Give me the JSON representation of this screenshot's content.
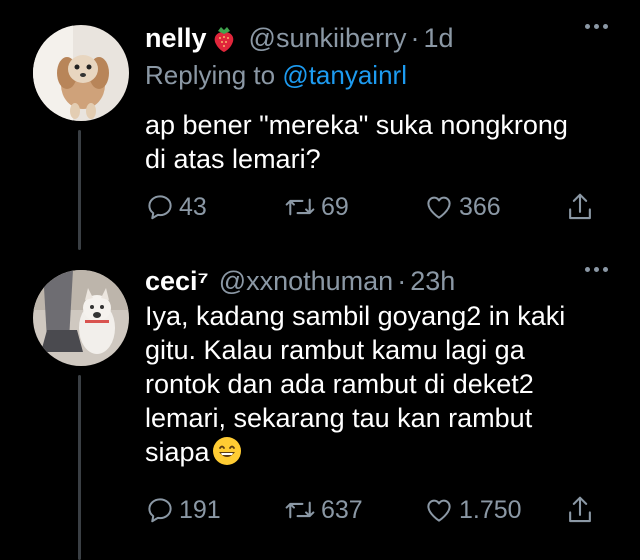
{
  "tweets": [
    {
      "display_name": "nelly",
      "name_emoji": "strawberry-emoji",
      "handle": "@sunkiiberry",
      "time_separator": "·",
      "time": "1d",
      "replying_prefix": "Replying to",
      "replying_to": "@tanyainrl",
      "text_lines": [
        "ap bener \"mereka\" suka nongkrong",
        "di atas lemari?"
      ],
      "replies": "43",
      "retweets": "69",
      "likes": "366",
      "avatar": "puppy-photo"
    },
    {
      "display_name": "ceci⁷",
      "handle": "@xxnothuman",
      "time_separator": "·",
      "time": "23h",
      "text_lines": [
        "Iya, kadang sambil goyang2 in kaki",
        "gitu. Kalau rambut kamu lagi ga",
        "rontok dan ada rambut di deket2",
        "lemari, sekarang tau kan rambut",
        "siapa"
      ],
      "text_emoji": "grinning-face-emoji",
      "replies": "191",
      "retweets": "637",
      "likes": "1.750",
      "avatar": "cat-photo"
    }
  ],
  "icons": {
    "reply": "reply-icon",
    "retweet": "retweet-icon",
    "like": "heart-icon",
    "share": "share-icon",
    "more": "more-icon"
  },
  "colors": {
    "background": "#000000",
    "text": "#ffffff",
    "secondary": "#8b98a5",
    "link": "#1d9bf0"
  }
}
